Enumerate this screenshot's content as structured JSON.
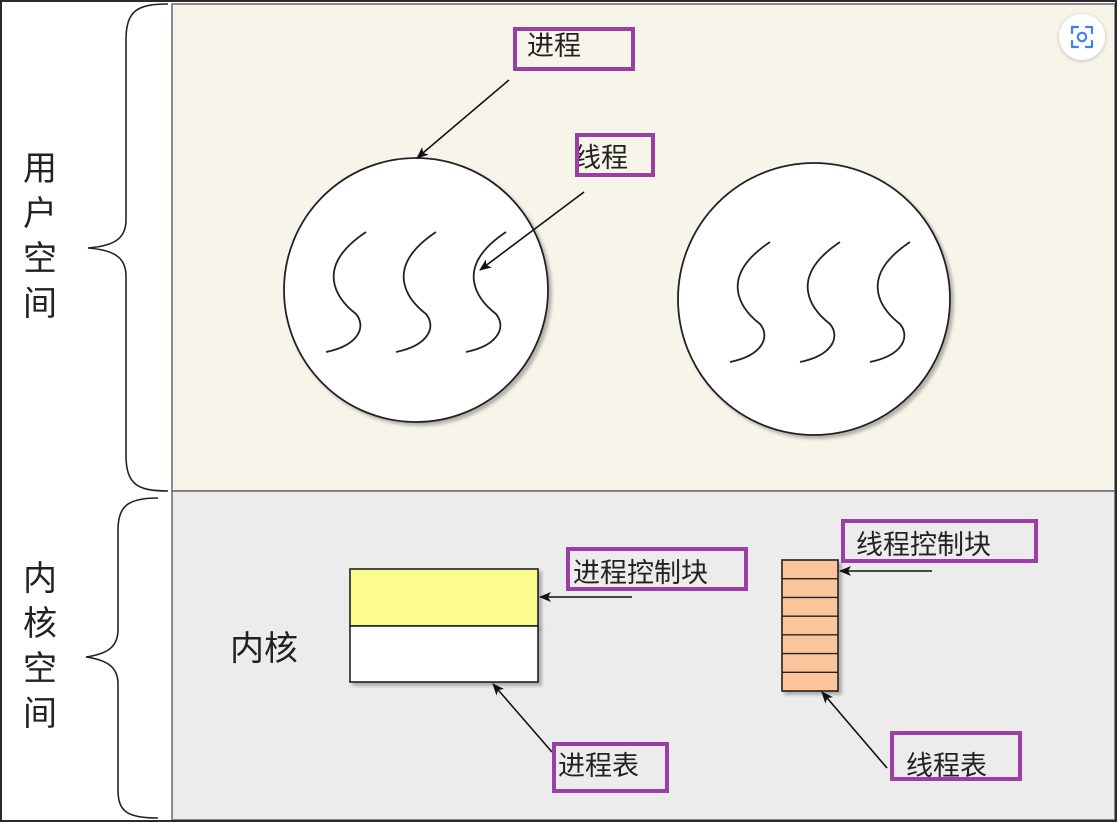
{
  "colors": {
    "user_space_bg": "#f7f5ea",
    "kernel_space_bg": "#ececec",
    "label_box_border": "#9b3ea6",
    "process_table_top": "#fbfb8e",
    "thread_table_fill": "#fbc49a",
    "scan_icon": "#3b82f6"
  },
  "icons": {
    "scan_button": "image-scan-icon"
  },
  "regions": {
    "user_space_label": "用户空间",
    "kernel_space_label": "内核空间",
    "kernel_inner_label": "内核"
  },
  "labels": {
    "process": "进程",
    "thread": "线程",
    "process_control_block": "进程控制块",
    "thread_control_block": "线程控制块",
    "process_table": "进程表",
    "thread_table": "线程表"
  },
  "diagram": {
    "processes": [
      {
        "threads": 3
      },
      {
        "threads": 3
      }
    ],
    "thread_table_rows": 7
  }
}
